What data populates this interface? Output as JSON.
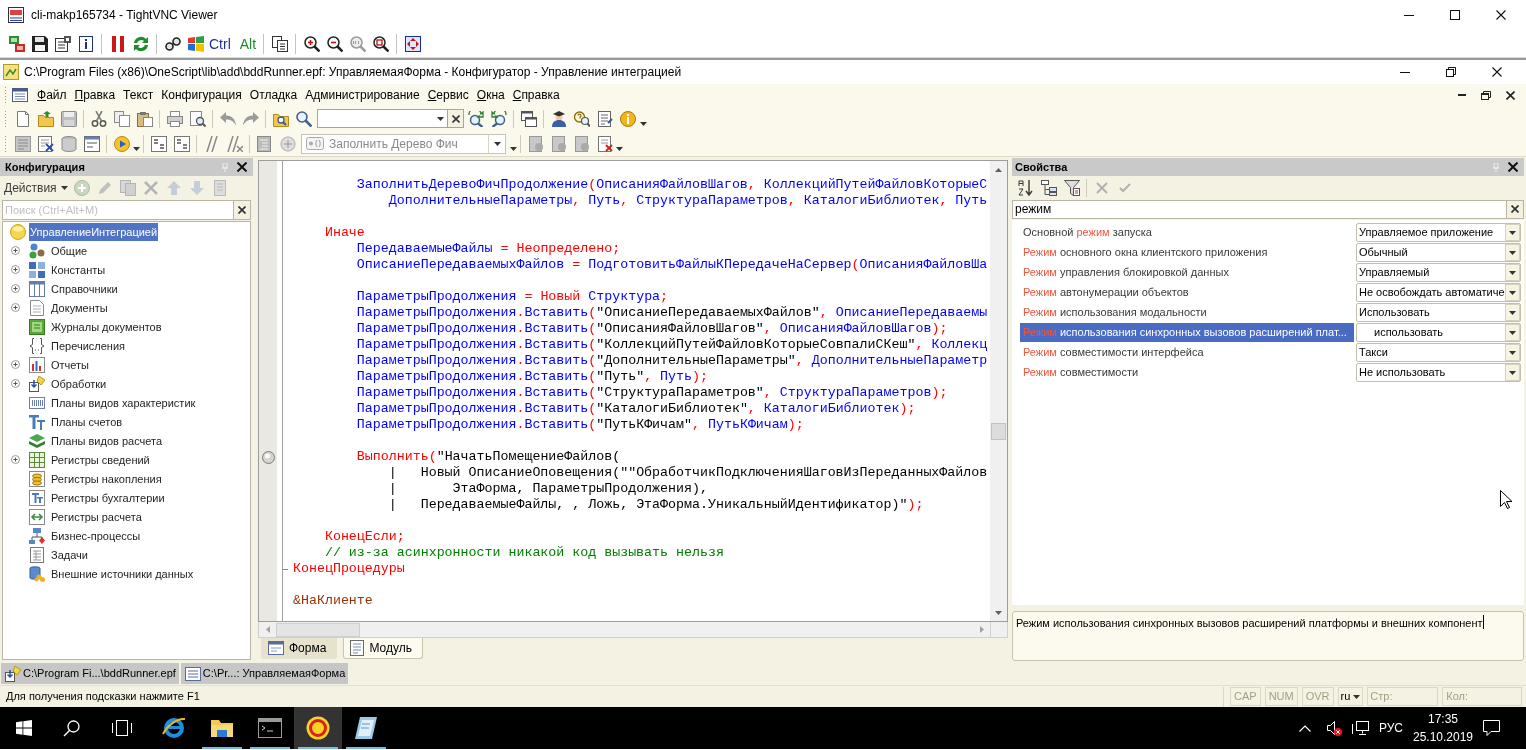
{
  "vnc_window": {
    "title": "cli-makp165734 - TightVNC Viewer"
  },
  "vnc_toolbar": {
    "ctrl_key": "Ctrl",
    "alt_key": "Alt"
  },
  "app_window": {
    "title": "C:\\Program Files (x86)\\OneScript\\lib\\add\\bddRunner.epf: УправляемаяФорма - Конфигуратор - Управление интеграцией"
  },
  "menu": [
    {
      "label": "Файл",
      "hotkey_underlined": true
    },
    {
      "label": "Правка",
      "hotkey_underlined": true
    },
    {
      "label": "Текст",
      "hotkey_underlined": false
    },
    {
      "label": "Конфигурация",
      "hotkey_underlined": false
    },
    {
      "label": "Отладка",
      "hotkey_underlined": false
    },
    {
      "label": "Администрирование",
      "hotkey_underlined": false
    },
    {
      "label": "Сервис",
      "hotkey_underlined": true
    },
    {
      "label": "Окна",
      "hotkey_underlined": true
    },
    {
      "label": "Справка",
      "hotkey_underlined": true
    }
  ],
  "procedure_selector": {
    "value": "Заполнить Дерево Фич",
    "disabled": true
  },
  "config_panel": {
    "title": "Конфигурация",
    "actions_label": "Действия",
    "search": {
      "placeholder": "Поиск (Ctrl+Alt+M)"
    },
    "tree": [
      {
        "label": "УправлениеИнтеграцией",
        "kind": "root",
        "expandable": false,
        "selected": true,
        "children": [
          {
            "label": "Общие",
            "kind": "common",
            "expandable": true,
            "selected": false
          },
          {
            "label": "Константы",
            "kind": "constants",
            "expandable": true,
            "selected": false
          },
          {
            "label": "Справочники",
            "kind": "catalogs",
            "expandable": true,
            "selected": false
          },
          {
            "label": "Документы",
            "kind": "documents",
            "expandable": true,
            "selected": false
          },
          {
            "label": "Журналы документов",
            "kind": "journals",
            "expandable": false,
            "selected": false
          },
          {
            "label": "Перечисления",
            "kind": "enums",
            "expandable": false,
            "selected": false
          },
          {
            "label": "Отчеты",
            "kind": "reports",
            "expandable": true,
            "selected": false
          },
          {
            "label": "Обработки",
            "kind": "dataprocessors",
            "expandable": true,
            "selected": false
          },
          {
            "label": "Планы видов характеристик",
            "kind": "characteristics",
            "expandable": false,
            "selected": false
          },
          {
            "label": "Планы счетов",
            "kind": "accounts",
            "expandable": false,
            "selected": false
          },
          {
            "label": "Планы видов расчета",
            "kind": "calculations",
            "expandable": false,
            "selected": false
          },
          {
            "label": "Регистры сведений",
            "kind": "inforegisters",
            "expandable": true,
            "selected": false
          },
          {
            "label": "Регистры накопления",
            "kind": "accumregisters",
            "expandable": false,
            "selected": false
          },
          {
            "label": "Регистры бухгалтерии",
            "kind": "accountingregisters",
            "expandable": false,
            "selected": false
          },
          {
            "label": "Регистры расчета",
            "kind": "calcregisters",
            "expandable": false,
            "selected": false
          },
          {
            "label": "Бизнес-процессы",
            "kind": "businessprocesses",
            "expandable": false,
            "selected": false
          },
          {
            "label": "Задачи",
            "kind": "tasks",
            "expandable": false,
            "selected": false
          },
          {
            "label": "Внешние источники данных",
            "kind": "externalsources",
            "expandable": false,
            "selected": false
          }
        ]
      }
    ]
  },
  "editor": {
    "lines": [
      {
        "kind": "blank"
      },
      {
        "kind": "code",
        "tokens": [
          {
            "kind": "ident",
            "text": "        ЗаполнитьДеревоФичПродолжение"
          },
          {
            "kind": "punct",
            "text": "("
          },
          {
            "kind": "ident",
            "text": "ОписанияФайловШагов"
          },
          {
            "kind": "punct",
            "text": ","
          },
          {
            "kind": "ident",
            "text": " КоллекцийПутейФайловКоторыеС"
          }
        ]
      },
      {
        "kind": "code",
        "tokens": [
          {
            "kind": "ident",
            "text": "            ДополнительныеПараметры"
          },
          {
            "kind": "punct",
            "text": ","
          },
          {
            "kind": "ident",
            "text": " Путь"
          },
          {
            "kind": "punct",
            "text": ","
          },
          {
            "kind": "ident",
            "text": " СтруктураПараметров"
          },
          {
            "kind": "punct",
            "text": ","
          },
          {
            "kind": "ident",
            "text": " КаталогиБиблиотек"
          },
          {
            "kind": "punct",
            "text": ","
          },
          {
            "kind": "ident",
            "text": " Путь"
          }
        ]
      },
      {
        "kind": "blank"
      },
      {
        "kind": "code",
        "tokens": [
          {
            "kind": "keyword",
            "text": "    Иначе"
          }
        ]
      },
      {
        "kind": "code",
        "tokens": [
          {
            "kind": "ident",
            "text": "        ПередаваемыеФайлы"
          },
          {
            "kind": "punct",
            "text": " = "
          },
          {
            "kind": "keyword",
            "text": "Неопределено"
          },
          {
            "kind": "punct",
            "text": ";"
          }
        ]
      },
      {
        "kind": "code",
        "tokens": [
          {
            "kind": "ident",
            "text": "        ОписаниеПередаваемыхФайлов"
          },
          {
            "kind": "punct",
            "text": " = "
          },
          {
            "kind": "ident",
            "text": "ПодготовитьФайлыКПередачеНаСервер"
          },
          {
            "kind": "punct",
            "text": "("
          },
          {
            "kind": "ident",
            "text": "ОписанияФайловШа"
          }
        ]
      },
      {
        "kind": "blank"
      },
      {
        "kind": "code",
        "tokens": [
          {
            "kind": "ident",
            "text": "        ПараметрыПродолжения"
          },
          {
            "kind": "punct",
            "text": " = "
          },
          {
            "kind": "keyword",
            "text": "Новый"
          },
          {
            "kind": "ident",
            "text": " Структура"
          },
          {
            "kind": "punct",
            "text": ";"
          }
        ]
      },
      {
        "kind": "code",
        "tokens": [
          {
            "kind": "ident",
            "text": "        ПараметрыПродолжения"
          },
          {
            "kind": "punct",
            "text": "."
          },
          {
            "kind": "ident",
            "text": "Вставить"
          },
          {
            "kind": "punct",
            "text": "("
          },
          {
            "kind": "string",
            "text": "\"ОписаниеПередаваемыхФайлов\""
          },
          {
            "kind": "punct",
            "text": ","
          },
          {
            "kind": "ident",
            "text": " ОписаниеПередаваемы"
          }
        ]
      },
      {
        "kind": "code",
        "tokens": [
          {
            "kind": "ident",
            "text": "        ПараметрыПродолжения"
          },
          {
            "kind": "punct",
            "text": "."
          },
          {
            "kind": "ident",
            "text": "Вставить"
          },
          {
            "kind": "punct",
            "text": "("
          },
          {
            "kind": "string",
            "text": "\"ОписанияФайловШагов\""
          },
          {
            "kind": "punct",
            "text": ","
          },
          {
            "kind": "ident",
            "text": " ОписанияФайловШагов"
          },
          {
            "kind": "punct",
            "text": ");"
          }
        ]
      },
      {
        "kind": "code",
        "tokens": [
          {
            "kind": "ident",
            "text": "        ПараметрыПродолжения"
          },
          {
            "kind": "punct",
            "text": "."
          },
          {
            "kind": "ident",
            "text": "Вставить"
          },
          {
            "kind": "punct",
            "text": "("
          },
          {
            "kind": "string",
            "text": "\"КоллекцийПутейФайловКоторыеСовпалиСКеш\""
          },
          {
            "kind": "punct",
            "text": ","
          },
          {
            "kind": "ident",
            "text": " Коллекц"
          }
        ]
      },
      {
        "kind": "code",
        "tokens": [
          {
            "kind": "ident",
            "text": "        ПараметрыПродолжения"
          },
          {
            "kind": "punct",
            "text": "."
          },
          {
            "kind": "ident",
            "text": "Вставить"
          },
          {
            "kind": "punct",
            "text": "("
          },
          {
            "kind": "string",
            "text": "\"ДополнительныеПараметры\""
          },
          {
            "kind": "punct",
            "text": ","
          },
          {
            "kind": "ident",
            "text": " ДополнительныеПараметр"
          }
        ]
      },
      {
        "kind": "code",
        "tokens": [
          {
            "kind": "ident",
            "text": "        ПараметрыПродолжения"
          },
          {
            "kind": "punct",
            "text": "."
          },
          {
            "kind": "ident",
            "text": "Вставить"
          },
          {
            "kind": "punct",
            "text": "("
          },
          {
            "kind": "string",
            "text": "\"Путь\""
          },
          {
            "kind": "punct",
            "text": ","
          },
          {
            "kind": "ident",
            "text": " Путь"
          },
          {
            "kind": "punct",
            "text": ");"
          }
        ]
      },
      {
        "kind": "code",
        "tokens": [
          {
            "kind": "ident",
            "text": "        ПараметрыПродолжения"
          },
          {
            "kind": "punct",
            "text": "."
          },
          {
            "kind": "ident",
            "text": "Вставить"
          },
          {
            "kind": "punct",
            "text": "("
          },
          {
            "kind": "string",
            "text": "\"СтруктураПараметров\""
          },
          {
            "kind": "punct",
            "text": ","
          },
          {
            "kind": "ident",
            "text": " СтруктураПараметров"
          },
          {
            "kind": "punct",
            "text": ");"
          }
        ]
      },
      {
        "kind": "code",
        "tokens": [
          {
            "kind": "ident",
            "text": "        ПараметрыПродолжения"
          },
          {
            "kind": "punct",
            "text": "."
          },
          {
            "kind": "ident",
            "text": "Вставить"
          },
          {
            "kind": "punct",
            "text": "("
          },
          {
            "kind": "string",
            "text": "\"КаталогиБиблиотек\""
          },
          {
            "kind": "punct",
            "text": ","
          },
          {
            "kind": "ident",
            "text": " КаталогиБиблиотек"
          },
          {
            "kind": "punct",
            "text": ");"
          }
        ]
      },
      {
        "kind": "code",
        "tokens": [
          {
            "kind": "ident",
            "text": "        ПараметрыПродолжения"
          },
          {
            "kind": "punct",
            "text": "."
          },
          {
            "kind": "ident",
            "text": "Вставить"
          },
          {
            "kind": "punct",
            "text": "("
          },
          {
            "kind": "string",
            "text": "\"ПутьКФичам\""
          },
          {
            "kind": "punct",
            "text": ","
          },
          {
            "kind": "ident",
            "text": " ПутьКФичам"
          },
          {
            "kind": "punct",
            "text": ");"
          }
        ]
      },
      {
        "kind": "blank"
      },
      {
        "kind": "breakpoint",
        "tokens": [
          {
            "kind": "keyword",
            "text": "        Выполнить"
          },
          {
            "kind": "punct",
            "text": "("
          },
          {
            "kind": "string",
            "text": "\"НачатьПомещениеФайлов("
          }
        ]
      },
      {
        "kind": "code",
        "tokens": [
          {
            "kind": "string",
            "text": "            |   Новый ОписаниеОповещения(\"\"ОбработчикПодключенияШаговИзПереданныхФайлов"
          }
        ]
      },
      {
        "kind": "code",
        "tokens": [
          {
            "kind": "string",
            "text": "            |       ЭтаФорма, ПараметрыПродолжения),"
          }
        ]
      },
      {
        "kind": "code",
        "tokens": [
          {
            "kind": "string",
            "text": "            |   ПередаваемыеФайлы, , Ложь, ЭтаФорма.УникальныйИдентификатор)\""
          },
          {
            "kind": "punct",
            "text": ");"
          }
        ]
      },
      {
        "kind": "blank"
      },
      {
        "kind": "code",
        "tokens": [
          {
            "kind": "keyword",
            "text": "    КонецЕсли;"
          }
        ]
      },
      {
        "kind": "code",
        "tokens": [
          {
            "kind": "comment",
            "text": "    // из-за асинхронности никакой код вызывать нельзя"
          }
        ]
      },
      {
        "kind": "block_end",
        "tokens": [
          {
            "kind": "keyword",
            "text": "КонецПроцедуры"
          }
        ]
      },
      {
        "kind": "blank"
      },
      {
        "kind": "code",
        "tokens": [
          {
            "kind": "directive",
            "text": "&НаКлиенте"
          }
        ]
      }
    ],
    "tabs": [
      {
        "label": "Форма",
        "kind": "form",
        "selected": false
      },
      {
        "label": "Модуль",
        "kind": "module",
        "selected": true
      }
    ]
  },
  "properties_panel": {
    "title": "Свойства",
    "search": {
      "value": "режим"
    },
    "rows": [
      {
        "name": [
          {
            "text": "Основной ",
            "match": false
          },
          {
            "text": "режим",
            "match": true
          },
          {
            "text": " запуска",
            "match": false
          }
        ],
        "value": "Управляемое приложение",
        "selected": false
      },
      {
        "name": [
          {
            "text": "Режим",
            "match": true
          },
          {
            "text": " основного окна клиентского приложения",
            "match": false
          }
        ],
        "value": "Обычный",
        "selected": false
      },
      {
        "name": [
          {
            "text": "Режим",
            "match": true
          },
          {
            "text": " управления блокировкой данных",
            "match": false
          }
        ],
        "value": "Управляемый",
        "selected": false
      },
      {
        "name": [
          {
            "text": "Режим",
            "match": true
          },
          {
            "text": " автонумерации объектов",
            "match": false
          }
        ],
        "value": "Не освобождать автоматиче",
        "selected": false
      },
      {
        "name": [
          {
            "text": "Режим",
            "match": true
          },
          {
            "text": " использования модальности",
            "match": false
          }
        ],
        "value": "Использовать",
        "selected": false
      },
      {
        "name": [
          {
            "text": "Режим",
            "match": true
          },
          {
            "text": " использования синхронных вызовов расширений плат...",
            "match": false
          }
        ],
        "value": "использовать",
        "selected": true
      },
      {
        "name": [
          {
            "text": "Режим",
            "match": true
          },
          {
            "text": " совместимости интерфейса",
            "match": false
          }
        ],
        "value": "Такси",
        "selected": false
      },
      {
        "name": [
          {
            "text": "Режим",
            "match": true
          },
          {
            "text": " совместимости",
            "match": false
          }
        ],
        "value": "Не использовать",
        "selected": false
      }
    ],
    "description": "Режим использования синхронных вызовов расширений платформы и внешних компонент"
  },
  "window_tabs": [
    {
      "label": "C:\\Program Fi...\\bddRunner.epf",
      "kind": "dataprocessor"
    },
    {
      "label": "C:\\Pr...: УправляемаяФорма",
      "kind": "form"
    }
  ],
  "status_bar": {
    "hint": "Для получения подсказки нажмите F1",
    "indicators": [
      {
        "label": "CAP",
        "on": false
      },
      {
        "label": "NUM",
        "on": false
      },
      {
        "label": "OVR",
        "on": false
      }
    ],
    "language": "ru",
    "line_label": "Стр:",
    "column_label": "Кол:"
  },
  "taskbar": {
    "apps": [
      {
        "kind": "browser",
        "running": false,
        "selected": false
      },
      {
        "kind": "explorer",
        "running": true,
        "selected": false
      },
      {
        "kind": "terminal",
        "running": true,
        "selected": false
      },
      {
        "kind": "onec",
        "running": true,
        "selected": true
      },
      {
        "kind": "notepad",
        "running": true,
        "selected": false
      }
    ],
    "volume_muted": true,
    "input_language": "РУС",
    "time": "17:35",
    "date": "25.10.2019"
  }
}
